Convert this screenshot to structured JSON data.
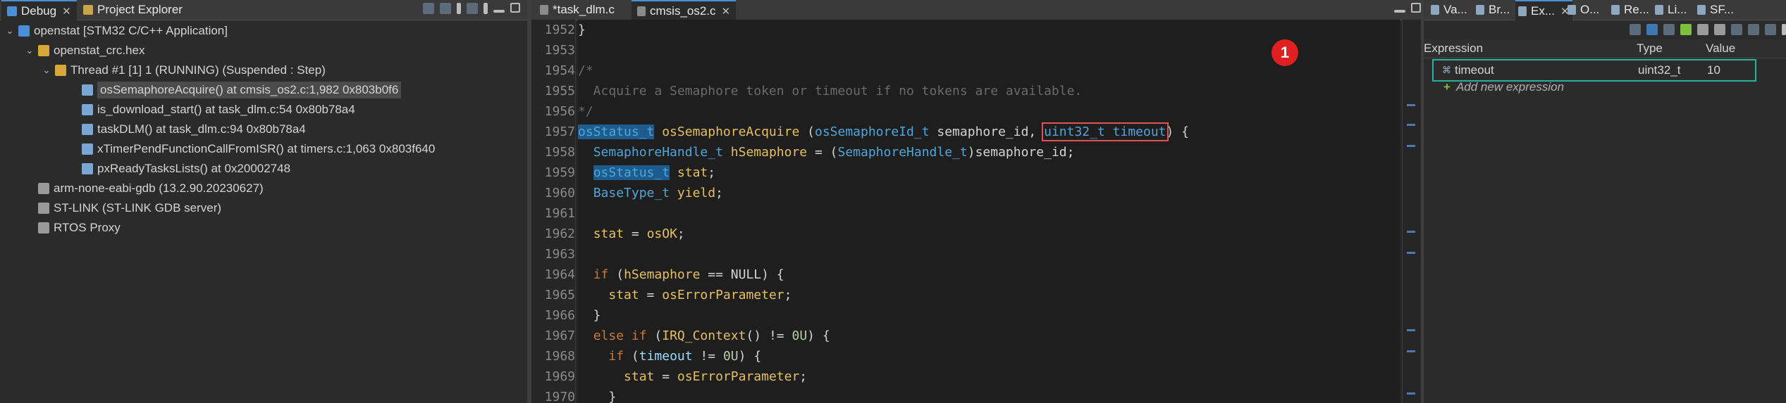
{
  "left": {
    "tabs": [
      {
        "label": "Debug"
      },
      {
        "label": "Project Explorer"
      }
    ],
    "tree": [
      {
        "label": "openstat [STM32 C/C++ Application]",
        "arrow": "⌄",
        "icon": "launch-config-icon",
        "color": "#4a8fd6"
      },
      {
        "label": "openstat_crc.hex",
        "arrow": "⌄",
        "icon": "process-icon",
        "color": "#d6a83a"
      },
      {
        "label": "Thread #1 [1] 1 (RUNNING) (Suspended : Step)",
        "arrow": "⌄",
        "icon": "thread-icon",
        "color": "#d6a83a"
      },
      {
        "label": "osSemaphoreAcquire() at cmsis_os2.c:1,982 0x803b0f6",
        "arrow": "",
        "icon": "stack-frame-icon",
        "color": "#7aa6d6",
        "selected": true
      },
      {
        "label": "is_download_start() at task_dlm.c:54 0x80b78a4",
        "arrow": "",
        "icon": "stack-frame-icon",
        "color": "#7aa6d6"
      },
      {
        "label": "taskDLM() at task_dlm.c:94 0x80b78a4",
        "arrow": "",
        "icon": "stack-frame-icon",
        "color": "#7aa6d6"
      },
      {
        "label": "xTimerPendFunctionCallFromISR() at timers.c:1,063 0x803f640",
        "arrow": "",
        "icon": "stack-frame-icon",
        "color": "#7aa6d6"
      },
      {
        "label": "pxReadyTasksLists() at 0x20002748",
        "arrow": "",
        "icon": "stack-frame-icon",
        "color": "#7aa6d6"
      },
      {
        "label": "arm-none-eabi-gdb (13.2.90.20230627)",
        "arrow": "",
        "icon": "gdb-icon",
        "color": "#9a9a9a"
      },
      {
        "label": "ST-LINK (ST-LINK GDB server)",
        "arrow": "",
        "icon": "stlink-icon",
        "color": "#9a9a9a"
      },
      {
        "label": "RTOS Proxy",
        "arrow": "",
        "icon": "rtos-proxy-icon",
        "color": "#9a9a9a"
      }
    ]
  },
  "editor": {
    "tabs": [
      {
        "label": "*task_dlm.c"
      },
      {
        "label": "cmsis_os2.c"
      }
    ],
    "badge": "1",
    "line_numbers": [
      "1952",
      "1953",
      "1954",
      "1955",
      "1956",
      "1957",
      "1958",
      "1959",
      "1960",
      "1961",
      "1962",
      "1963",
      "1964",
      "1965",
      "1966",
      "1967",
      "1968",
      "1969",
      "1970"
    ],
    "lines": [
      [
        {
          "t": "}"
        }
      ],
      [],
      [
        {
          "t": "/*",
          "c": "cm"
        }
      ],
      [
        {
          "t": "  Acquire a Semaphore token or timeout if no tokens are available.",
          "c": "cm"
        }
      ],
      [
        {
          "t": "*/",
          "c": "cm"
        }
      ],
      [
        {
          "t": "osStatus_t",
          "c": "ty hl"
        },
        {
          "t": " "
        },
        {
          "t": "osSemaphoreAcquire",
          "c": "fn"
        },
        {
          "t": " ("
        },
        {
          "t": "osSemaphoreId_t",
          "c": "ty"
        },
        {
          "t": " semaphore_id, "
        },
        {
          "t": "uint32_t timeout",
          "c": "ty redbox"
        },
        {
          "t": ") {"
        }
      ],
      [
        {
          "t": "  "
        },
        {
          "t": "SemaphoreHandle_t",
          "c": "ty"
        },
        {
          "t": " "
        },
        {
          "t": "hSemaphore",
          "c": "fn"
        },
        {
          "t": " = ("
        },
        {
          "t": "SemaphoreHandle_t",
          "c": "ty"
        },
        {
          "t": ")semaphore_id;"
        }
      ],
      [
        {
          "t": "  "
        },
        {
          "t": "osStatus_t",
          "c": "ty hl"
        },
        {
          "t": " "
        },
        {
          "t": "stat",
          "c": "fn"
        },
        {
          "t": ";"
        }
      ],
      [
        {
          "t": "  "
        },
        {
          "t": "BaseType_t",
          "c": "ty"
        },
        {
          "t": " "
        },
        {
          "t": "yield",
          "c": "fn"
        },
        {
          "t": ";"
        }
      ],
      [],
      [
        {
          "t": "  "
        },
        {
          "t": "stat",
          "c": "fn"
        },
        {
          "t": " = "
        },
        {
          "t": "osOK",
          "c": "fn"
        },
        {
          "t": ";"
        }
      ],
      [],
      [
        {
          "t": "  "
        },
        {
          "t": "if",
          "c": "k"
        },
        {
          "t": " ("
        },
        {
          "t": "hSemaphore",
          "c": "fn"
        },
        {
          "t": " == NULL) {"
        }
      ],
      [
        {
          "t": "    "
        },
        {
          "t": "stat",
          "c": "fn"
        },
        {
          "t": " = "
        },
        {
          "t": "osErrorParameter",
          "c": "fn"
        },
        {
          "t": ";"
        }
      ],
      [
        {
          "t": "  }"
        }
      ],
      [
        {
          "t": "  "
        },
        {
          "t": "else if",
          "c": "k"
        },
        {
          "t": " ("
        },
        {
          "t": "IRQ_Context",
          "c": "fn"
        },
        {
          "t": "() != "
        },
        {
          "t": "0U",
          "c": "num"
        },
        {
          "t": ") {"
        }
      ],
      [
        {
          "t": "    "
        },
        {
          "t": "if",
          "c": "k"
        },
        {
          "t": " ("
        },
        {
          "t": "timeout",
          "c": "p"
        },
        {
          "t": " != "
        },
        {
          "t": "0U",
          "c": "num"
        },
        {
          "t": ") {"
        }
      ],
      [
        {
          "t": "      "
        },
        {
          "t": "stat",
          "c": "fn"
        },
        {
          "t": " = "
        },
        {
          "t": "osErrorParameter",
          "c": "fn"
        },
        {
          "t": ";"
        }
      ],
      [
        {
          "t": "    }"
        }
      ]
    ]
  },
  "right": {
    "tabs": [
      {
        "label": "Va..."
      },
      {
        "label": "Br..."
      },
      {
        "label": "Ex..."
      },
      {
        "label": "O..."
      },
      {
        "label": "Re..."
      },
      {
        "label": "Li..."
      },
      {
        "label": "SF..."
      }
    ],
    "columns": {
      "expression": "Expression",
      "type": "Type",
      "value": "Value"
    },
    "expressions": [
      {
        "name": "timeout",
        "type": "uint32_t",
        "value": "10"
      }
    ],
    "add_label": "Add new expression"
  }
}
